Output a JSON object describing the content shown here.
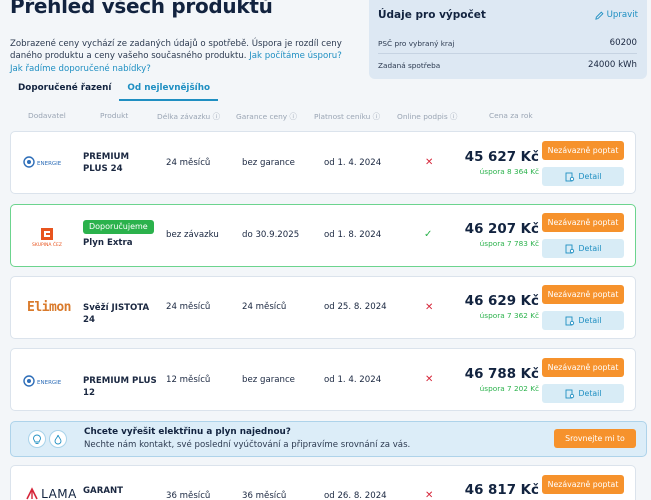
{
  "page": {
    "title": "Přehled všech produktů",
    "intro_text": "Zobrazené ceny vychází ze zadaných údajů o spotřebě. Úspora je rozdíl ceny daného produktu a ceny vašeho současného produktu. ",
    "intro_link1": "Jak počítáme úsporu?",
    "intro_link2": "Jak řadíme doporučené nabídky?"
  },
  "calc_box": {
    "title": "Údaje pro výpočet",
    "edit_label": "Upravit",
    "rows": [
      {
        "label": "PSČ pro vybraný kraj",
        "value": "60200"
      },
      {
        "label": "Zadaná spotřeba",
        "value": "24000 kWh"
      }
    ]
  },
  "tabs": [
    {
      "label": "Doporučené řazení",
      "active": false
    },
    {
      "label": "Od nejlevnějšího",
      "active": true
    }
  ],
  "columns": [
    "Dodavatel",
    "Produkt",
    "Délka závazku ⓘ",
    "Garance ceny ⓘ",
    "Platnost ceníku ⓘ",
    "Online podpis ⓘ",
    "Cena za rok"
  ],
  "buttons": {
    "offer": "Nezávazně poptat",
    "detail": "Detail"
  },
  "products": [
    {
      "supplier": "innogy energie",
      "logo_text": "ENERGIE",
      "name": "PREMIUM PLUS 24",
      "badge": "",
      "commitment": "24 měsíců",
      "guarantee": "bez garance",
      "valid_from": "od 1. 4. 2024",
      "online_sign": false,
      "price": "45 627 Kč",
      "saving": "úspora 8 364 Kč"
    },
    {
      "supplier": "Skupina ČEZ",
      "logo_text": "SKUPINA ČEZ",
      "name": "Plyn Extra",
      "badge": "Doporučujeme",
      "commitment": "bez závazku",
      "guarantee": "do 30.9.2025",
      "valid_from": "od 1. 8. 2024",
      "online_sign": true,
      "price": "46 207 Kč",
      "saving": "úspora 7 783 Kč"
    },
    {
      "supplier": "Elimon",
      "logo_text": "Elimon",
      "name": "Svěží JISTOTA 24",
      "badge": "",
      "commitment": "24 měsíců",
      "guarantee": "24 měsíců",
      "valid_from": "od 25. 8. 2024",
      "online_sign": false,
      "price": "46 629 Kč",
      "saving": "úspora 7 362 Kč"
    },
    {
      "supplier": "innogy energie",
      "logo_text": "ENERGIE",
      "name": "PREMIUM PLUS 12",
      "badge": "",
      "commitment": "12 měsíců",
      "guarantee": "bez garance",
      "valid_from": "od 1. 4. 2024",
      "online_sign": false,
      "price": "46 788 Kč",
      "saving": "úspora 7 202 Kč"
    },
    {
      "supplier": "LAMA",
      "logo_text": "LAMA",
      "name": "GARANT",
      "badge": "",
      "commitment": "36 měsíců",
      "guarantee": "36 měsíců",
      "valid_from": "od 26. 8. 2024",
      "online_sign": false,
      "price": "46 817 Kč",
      "saving": ""
    }
  ],
  "banner": {
    "title": "Chcete vyřešit elektřinu a plyn najednou?",
    "text": "Nechte nám kontakt, své poslední vyúčtování a připravíme srovnání za vás.",
    "button": "Srovnejte mi to"
  },
  "marks": {
    "no": "✕",
    "yes": "✓"
  },
  "colors": {
    "accent": "#1f8fc2",
    "orange": "#f6922c",
    "green": "#2bb24c",
    "red": "#d6263a"
  }
}
